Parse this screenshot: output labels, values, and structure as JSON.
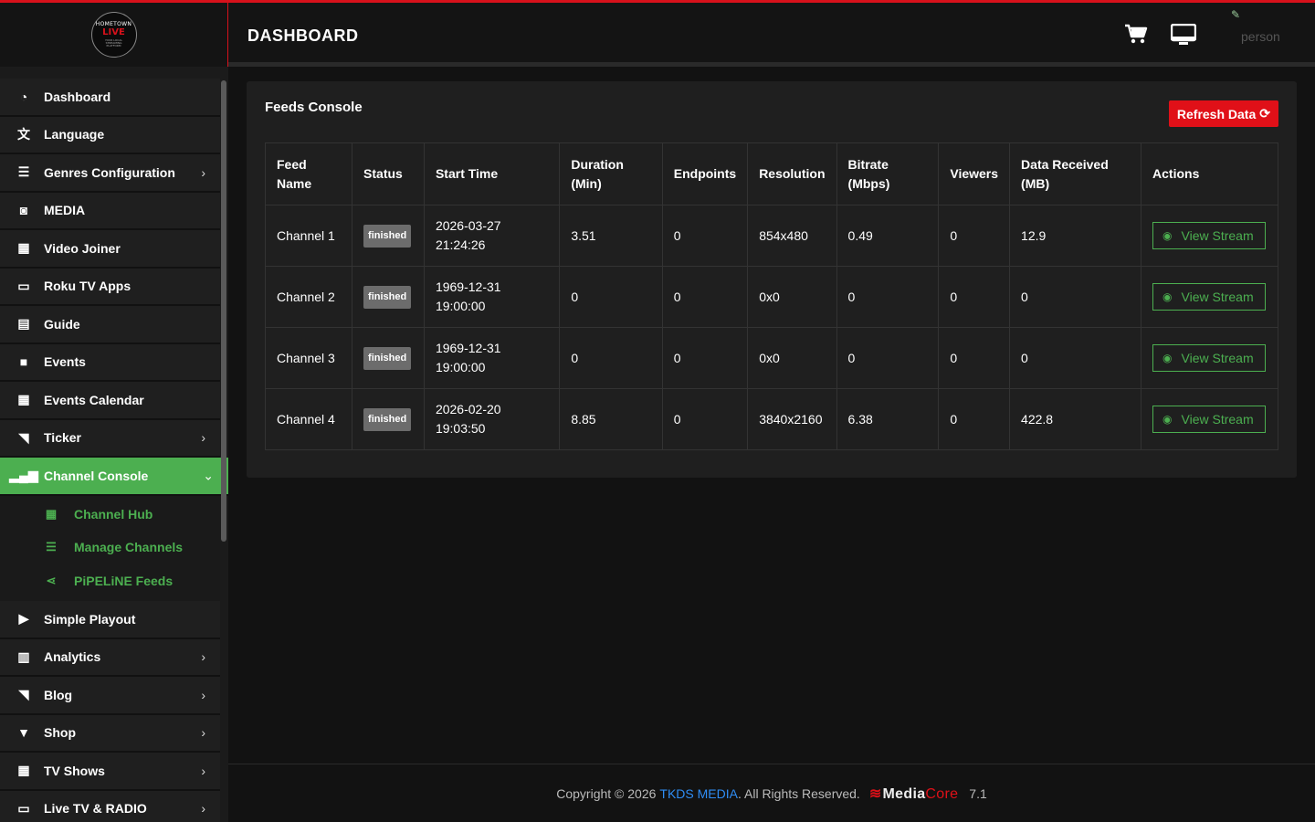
{
  "logo": {
    "line1": "HOMETOWN",
    "line2": "LIVE",
    "tagline": "YOUR LOCAL STREAMING PLATFORM"
  },
  "header": {
    "title": "DASHBOARD",
    "user": "person"
  },
  "sidebar": {
    "items": [
      {
        "label": "Dashboard",
        "icon": "dashboard-icon",
        "glyph": "◔"
      },
      {
        "label": "Language",
        "icon": "language-icon",
        "glyph": "文"
      },
      {
        "label": "Genres Configuration",
        "icon": "list-icon",
        "glyph": "☰",
        "chevron": "›"
      },
      {
        "label": "MEDIA",
        "icon": "camera-icon",
        "glyph": "◙"
      },
      {
        "label": "Video Joiner",
        "icon": "film-icon",
        "glyph": "▦"
      },
      {
        "label": "Roku TV Apps",
        "icon": "monitor-icon",
        "glyph": "▭"
      },
      {
        "label": "Guide",
        "icon": "book-icon",
        "glyph": "▤"
      },
      {
        "label": "Events",
        "icon": "video-camera-icon",
        "glyph": "■"
      },
      {
        "label": "Events Calendar",
        "icon": "calendar-icon",
        "glyph": "▦"
      },
      {
        "label": "Ticker",
        "icon": "rss-icon",
        "glyph": "◥",
        "chevron": "›"
      },
      {
        "label": "Channel Console",
        "icon": "signal-icon",
        "glyph": "▂▄▆",
        "chevron": "⌄"
      }
    ],
    "submenu": [
      {
        "label": "Channel Hub",
        "icon": "grid-icon",
        "glyph": "▦"
      },
      {
        "label": "Manage Channels",
        "icon": "list-icon",
        "glyph": "☰"
      },
      {
        "label": "PiPELiNE Feeds",
        "icon": "share-icon",
        "glyph": "⋖"
      }
    ],
    "items_after": [
      {
        "label": "Simple Playout",
        "icon": "play-circle-icon",
        "glyph": "▶"
      },
      {
        "label": "Analytics",
        "icon": "bar-chart-icon",
        "glyph": "▥",
        "chevron": "›"
      },
      {
        "label": "Blog",
        "icon": "rss-icon",
        "glyph": "◥",
        "chevron": "›"
      },
      {
        "label": "Shop",
        "icon": "cart-icon",
        "glyph": "▼",
        "chevron": "›"
      },
      {
        "label": "TV Shows",
        "icon": "film-icon",
        "glyph": "▦",
        "chevron": "›"
      },
      {
        "label": "Live TV & RADIO",
        "icon": "monitor-icon",
        "glyph": "▭",
        "chevron": "›"
      }
    ]
  },
  "card": {
    "title": "Feeds Console",
    "refresh_label": "Refresh Data",
    "columns": [
      [
        "Feed",
        "Name"
      ],
      [
        "Status"
      ],
      [
        "Start Time"
      ],
      [
        "Duration",
        "(Min)"
      ],
      [
        "Endpoints"
      ],
      [
        "Resolution"
      ],
      [
        "Bitrate",
        "(Mbps)"
      ],
      [
        "Viewers"
      ],
      [
        "Data Received",
        "(MB)"
      ],
      [
        "Actions"
      ]
    ],
    "rows": [
      {
        "name": "Channel 1",
        "status": "finished",
        "start_date": "2026-03-27",
        "start_time": "21:24:26",
        "duration": "3.51",
        "endpoints": "0",
        "resolution": "854x480",
        "bitrate": "0.49",
        "viewers": "0",
        "data": "12.9",
        "action": "View Stream"
      },
      {
        "name": "Channel 2",
        "status": "finished",
        "start_date": "1969-12-31",
        "start_time": "19:00:00",
        "duration": "0",
        "endpoints": "0",
        "resolution": "0x0",
        "bitrate": "0",
        "viewers": "0",
        "data": "0",
        "action": "View Stream"
      },
      {
        "name": "Channel 3",
        "status": "finished",
        "start_date": "1969-12-31",
        "start_time": "19:00:00",
        "duration": "0",
        "endpoints": "0",
        "resolution": "0x0",
        "bitrate": "0",
        "viewers": "0",
        "data": "0",
        "action": "View Stream"
      },
      {
        "name": "Channel 4",
        "status": "finished",
        "start_date": "2026-02-20",
        "start_time": "19:03:50",
        "duration": "8.85",
        "endpoints": "0",
        "resolution": "3840x2160",
        "bitrate": "6.38",
        "viewers": "0",
        "data": "422.8",
        "action": "View Stream"
      }
    ]
  },
  "footer": {
    "copyright": "Copyright © 2026",
    "company": "TKDS MEDIA",
    "rights": ". All Rights Reserved.",
    "brand_media": "Media",
    "brand_core": "Core",
    "version": "7.1"
  },
  "colors": {
    "accent_red": "#e01018",
    "accent_green": "#4caf50",
    "link_blue": "#2f8df5"
  }
}
